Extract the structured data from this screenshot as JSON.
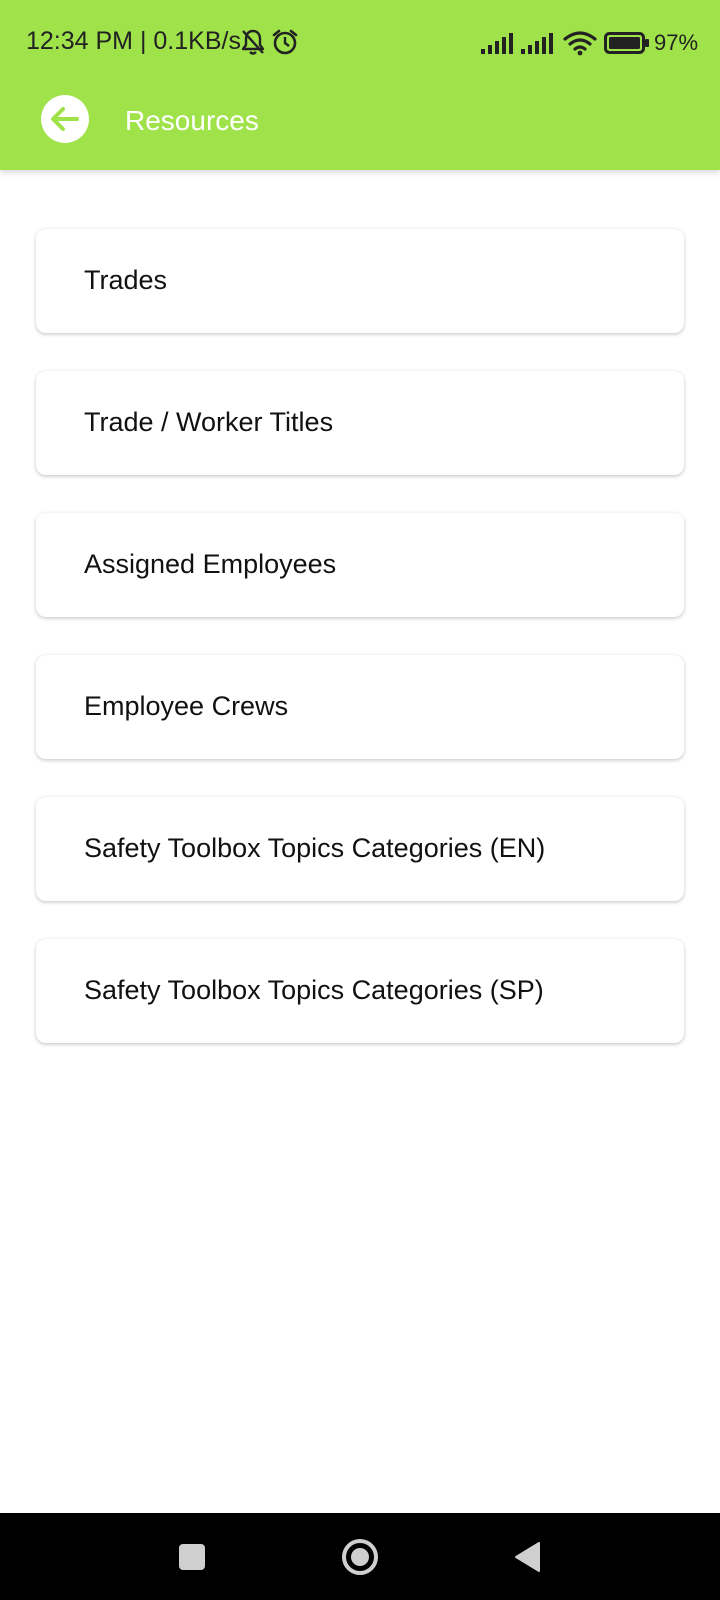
{
  "status_bar": {
    "time_text": "12:34 PM | 0.1KB/s",
    "battery_text": "97%",
    "icons": [
      "mute-bell-icon",
      "alarm-icon",
      "signal-icon",
      "signal-icon",
      "wifi-icon",
      "battery-icon"
    ]
  },
  "header": {
    "title": "Resources",
    "back_icon": "arrow-left-icon",
    "background_color": "#9fe24a"
  },
  "items": [
    {
      "label": "Trades"
    },
    {
      "label": "Trade / Worker Titles"
    },
    {
      "label": "Assigned Employees"
    },
    {
      "label": "Employee Crews"
    },
    {
      "label": "Safety Toolbox Topics Categories (EN)"
    },
    {
      "label": "Safety Toolbox Topics Categories (SP)"
    }
  ],
  "nav_bar": {
    "icons": [
      "recents-square-icon",
      "home-circle-icon",
      "back-triangle-icon"
    ]
  }
}
